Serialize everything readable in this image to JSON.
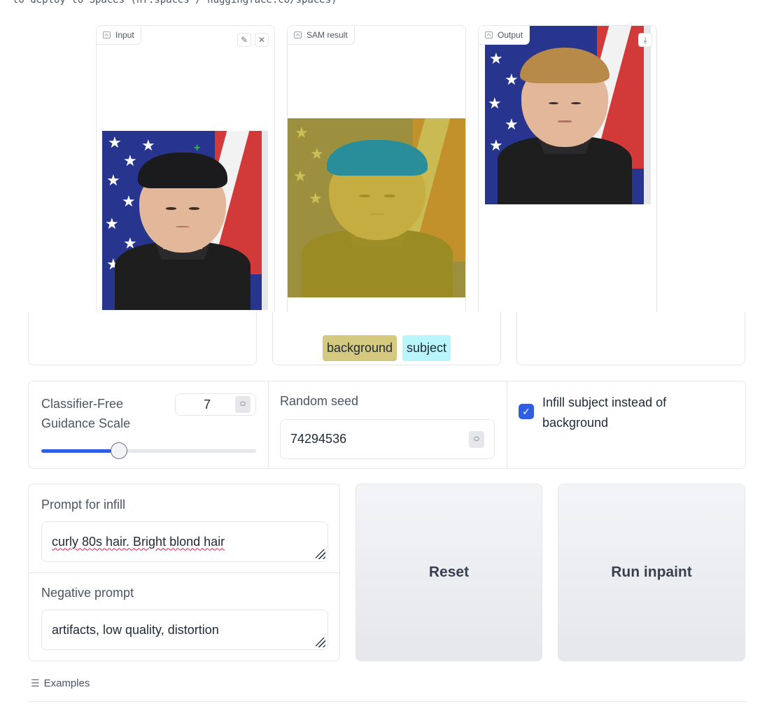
{
  "header_snippet": "to deploy to Spaces (hf.spaces / huggingface.co/spaces)",
  "panels": {
    "input": {
      "label": "Input"
    },
    "sam": {
      "label": "SAM result"
    },
    "output": {
      "label": "Output"
    }
  },
  "segment_chips": [
    {
      "label": "background",
      "color": "#d4c97e"
    },
    {
      "label": "subject",
      "color": "#b9f6fb"
    }
  ],
  "guidance": {
    "label": "Classifier-Free Guidance Scale",
    "value": "7",
    "slider_fraction": 0.36
  },
  "seed": {
    "label": "Random seed",
    "value": "74294536"
  },
  "infill_subject": {
    "label": "Infill subject instead of background",
    "checked": true
  },
  "prompt": {
    "label": "Prompt for infill",
    "value": "curly 80s hair. Bright blond hair"
  },
  "negative_prompt": {
    "label": "Negative prompt",
    "value": "artifacts, low quality, distortion"
  },
  "buttons": {
    "reset": "Reset",
    "run": "Run inpaint"
  },
  "examples": {
    "label": "Examples"
  },
  "colors": {
    "accent": "#2f5ee4",
    "mask_overlay": "#bea828",
    "mask_hair": "#2a8e9a"
  }
}
